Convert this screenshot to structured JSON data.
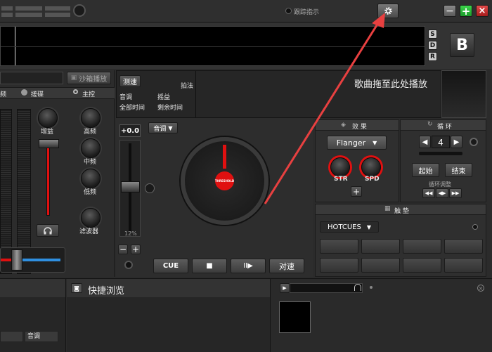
{
  "top_bar": {
    "monitor_label": "跟踪指示",
    "settings_icon": "gear-icon"
  },
  "window_controls": {
    "minimize": "−",
    "maximize": "+",
    "close": "×"
  },
  "waveform_side": {
    "s": "S",
    "d": "D",
    "r": "R",
    "deck": "B"
  },
  "mixer": {
    "sampler_button": "沙箱播放",
    "col_freq": "频",
    "col_scratch": "搓碟",
    "col_master": "主控",
    "gain": "增益",
    "high": "高频",
    "mid": "中频",
    "low": "低频",
    "filter": "滤波器"
  },
  "track_info": {
    "tempo_button": "测速",
    "beat": "拍法",
    "key": "音调",
    "bpm": "摇益",
    "total_time": "全部时间",
    "remain_time": "剩余时间",
    "drop_hint": "歌曲拖至此处播放"
  },
  "deck": {
    "pitch_value": "+0.0",
    "pitch_range": "12%",
    "key_select": "音调",
    "platter_label": "THRESHOLD",
    "cue": "CUE",
    "stop": "■",
    "play": "II▶",
    "sync": "对速"
  },
  "effects": {
    "title": "效 果",
    "selected": "Flanger",
    "str": "STR",
    "spd": "SPD",
    "add": "+"
  },
  "loop": {
    "title": "循 环",
    "value": "4",
    "start": "起始",
    "end": "结束",
    "adjust": "循环调整"
  },
  "hotcues": {
    "title": "触 垫",
    "select": "HOTCUES"
  },
  "browser": {
    "title": "快捷浏览",
    "col_key": "音调"
  },
  "colors": {
    "accent_red": "#e01010",
    "gain_bar": "#e01010",
    "crossfader_blue": "#2f8fe0",
    "arrow": "#e84040"
  }
}
